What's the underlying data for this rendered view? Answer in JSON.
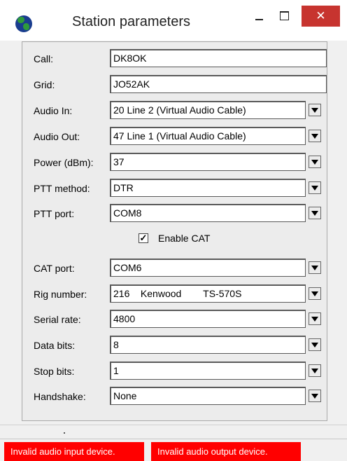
{
  "window": {
    "title": "Station parameters",
    "minimize_glyph": "",
    "maximize_glyph": "",
    "close_glyph": "✕",
    "app_icon": "globe-icon"
  },
  "form": {
    "call": {
      "label": "Call:",
      "value": "DK8OK"
    },
    "grid": {
      "label": "Grid:",
      "value": "JO52AK"
    },
    "audio_in": {
      "label": "Audio In:",
      "value": "20 Line 2 (Virtual Audio Cable)"
    },
    "audio_out": {
      "label": "Audio Out:",
      "value": "47 Line 1 (Virtual Audio Cable)"
    },
    "power": {
      "label": "Power (dBm):",
      "value": "37"
    },
    "ptt_method": {
      "label": "PTT method:",
      "value": "DTR"
    },
    "ptt_port": {
      "label": "PTT port:",
      "value": "COM8"
    },
    "enable_cat": {
      "label": "Enable CAT",
      "checked": true,
      "check_glyph": "✓"
    },
    "cat_port": {
      "label": "CAT port:",
      "value": "COM6"
    },
    "rig_number": {
      "label": "Rig number:",
      "value": "216    Kenwood        TS-570S"
    },
    "serial_rate": {
      "label": "Serial rate:",
      "value": "4800"
    },
    "data_bits": {
      "label": "Data bits:",
      "value": "8"
    },
    "stop_bits": {
      "label": "Stop bits:",
      "value": "1"
    },
    "handshake": {
      "label": "Handshake:",
      "value": "None"
    }
  },
  "status": {
    "input_error": "Invalid audio input device.",
    "output_error": "Invalid audio output device.",
    "error_color": "#ff0000"
  }
}
